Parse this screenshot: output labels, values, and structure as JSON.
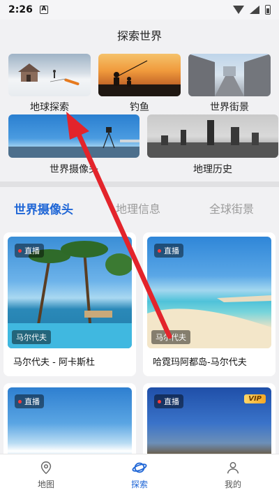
{
  "status": {
    "time": "2:26",
    "notif_badge": "A"
  },
  "header": {
    "title": "探索世界"
  },
  "tiles": [
    {
      "label": "地球探索"
    },
    {
      "label": "钓鱼"
    },
    {
      "label": "世界街景"
    },
    {
      "label": "世界摄像头"
    },
    {
      "label": "地理历史"
    }
  ],
  "tabs": [
    {
      "label": "世界摄像头"
    },
    {
      "label": "地理信息"
    },
    {
      "label": "全球街景"
    }
  ],
  "cards": [
    {
      "live": "直播",
      "location": "马尔代夫",
      "title": "马尔代夫 - 阿卡斯杜"
    },
    {
      "live": "直播",
      "location": "马尔代夫",
      "title": "哈霓玛阿都岛-马尔代夫"
    },
    {
      "live": "直播"
    },
    {
      "live": "直播",
      "vip": "VIP"
    }
  ],
  "bottom_nav": [
    {
      "label": "地图",
      "icon": "map-pin-icon"
    },
    {
      "label": "探索",
      "icon": "planet-icon"
    },
    {
      "label": "我的",
      "icon": "user-icon"
    }
  ],
  "colors": {
    "accent": "#1f66d6",
    "annotation_arrow": "#e3242b"
  }
}
